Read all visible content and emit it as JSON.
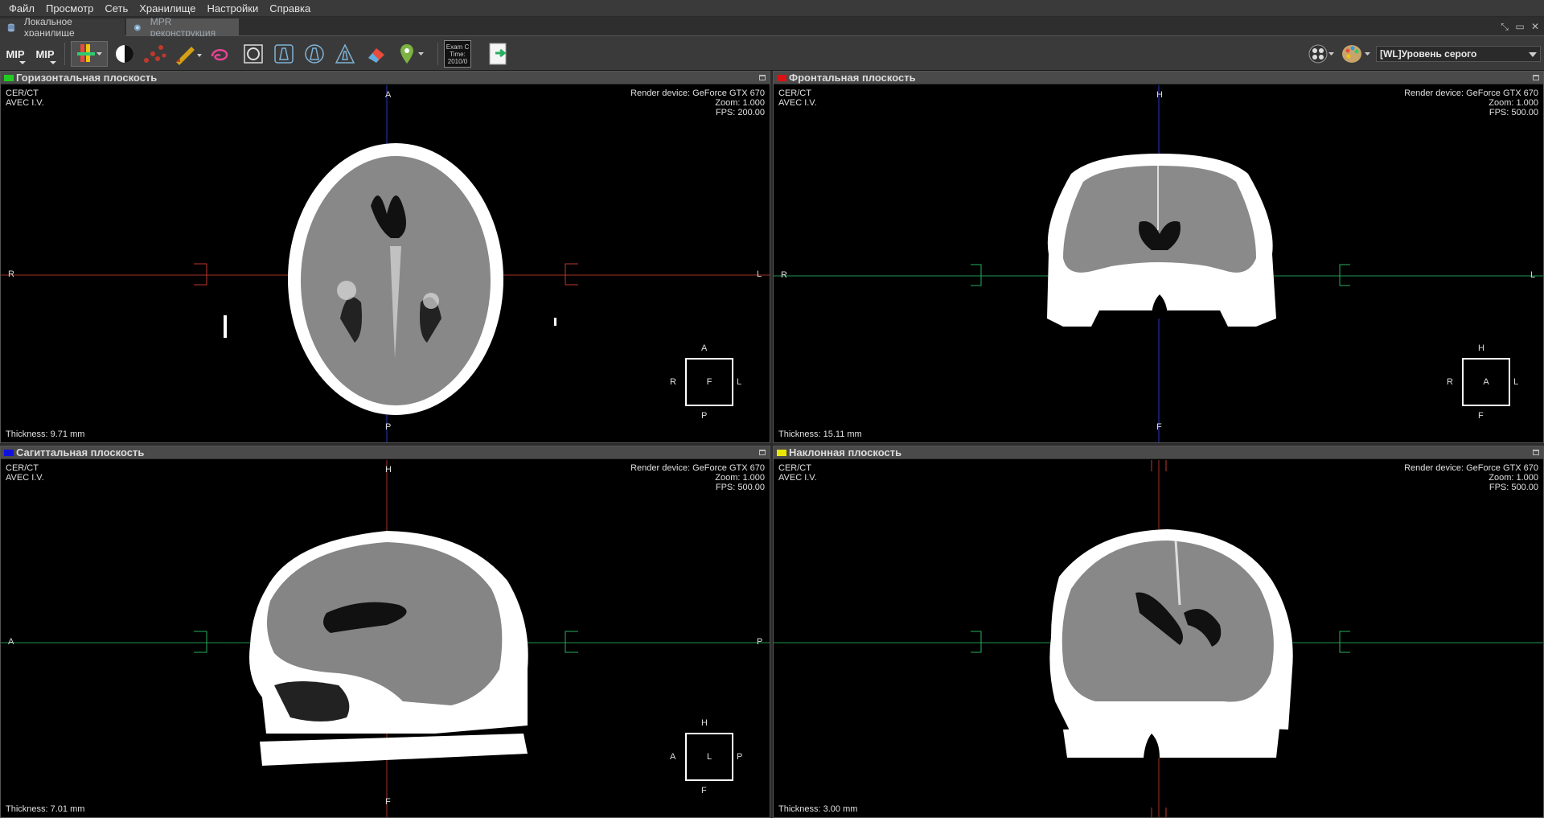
{
  "menu": [
    "Файл",
    "Просмотр",
    "Сеть",
    "Хранилище",
    "Настройки",
    "Справка"
  ],
  "tabs": [
    {
      "label": "Локальное хранилище"
    },
    {
      "label": "MPR реконструкция"
    }
  ],
  "toolbar": {
    "mip1": "MIP",
    "mip2": "MIP",
    "exam_lines": [
      "Exam C",
      "Time:",
      "2010/0"
    ],
    "wl_preset": "[WL]Уровень серого"
  },
  "viewports": [
    {
      "title": "Горизонтальная плоскость",
      "color": "#22cc22",
      "patient1": "CER/CT",
      "patient2": "AVEC I.V.",
      "render": "Render device: GeForce GTX 670",
      "zoom": "Zoom: 1.000",
      "fps": "FPS: 200.00",
      "thickness": "Thickness: 9.71 mm",
      "top": "A",
      "bottom": "P",
      "left": "R",
      "right": "L",
      "cube": {
        "center": "F",
        "top": "A",
        "bottom": "P",
        "left": "R",
        "right": "L"
      }
    },
    {
      "title": "Фронтальная плоскость",
      "color": "#dd1111",
      "patient1": "CER/CT",
      "patient2": "AVEC I.V.",
      "render": "Render device: GeForce GTX 670",
      "zoom": "Zoom: 1.000",
      "fps": "FPS: 500.00",
      "thickness": "Thickness: 15.11 mm",
      "top": "H",
      "bottom": "F",
      "left": "R",
      "right": "L",
      "cube": {
        "center": "A",
        "top": "H",
        "bottom": "F",
        "left": "R",
        "right": "L"
      }
    },
    {
      "title": "Сагиттальная плоскость",
      "color": "#1111dd",
      "patient1": "CER/CT",
      "patient2": "AVEC I.V.",
      "render": "Render device: GeForce GTX 670",
      "zoom": "Zoom: 1.000",
      "fps": "FPS: 500.00",
      "thickness": "Thickness: 7.01 mm",
      "top": "H",
      "bottom": "F",
      "left": "A",
      "right": "P",
      "cube": {
        "center": "L",
        "top": "H",
        "bottom": "F",
        "left": "A",
        "right": "P"
      }
    },
    {
      "title": "Наклонная плоскость",
      "color": "#e8e800",
      "patient1": "CER/CT",
      "patient2": "AVEC I.V.",
      "render": "Render device: GeForce GTX 670",
      "zoom": "Zoom: 1.000",
      "fps": "FPS: 500.00",
      "thickness": "Thickness: 3.00 mm"
    }
  ]
}
